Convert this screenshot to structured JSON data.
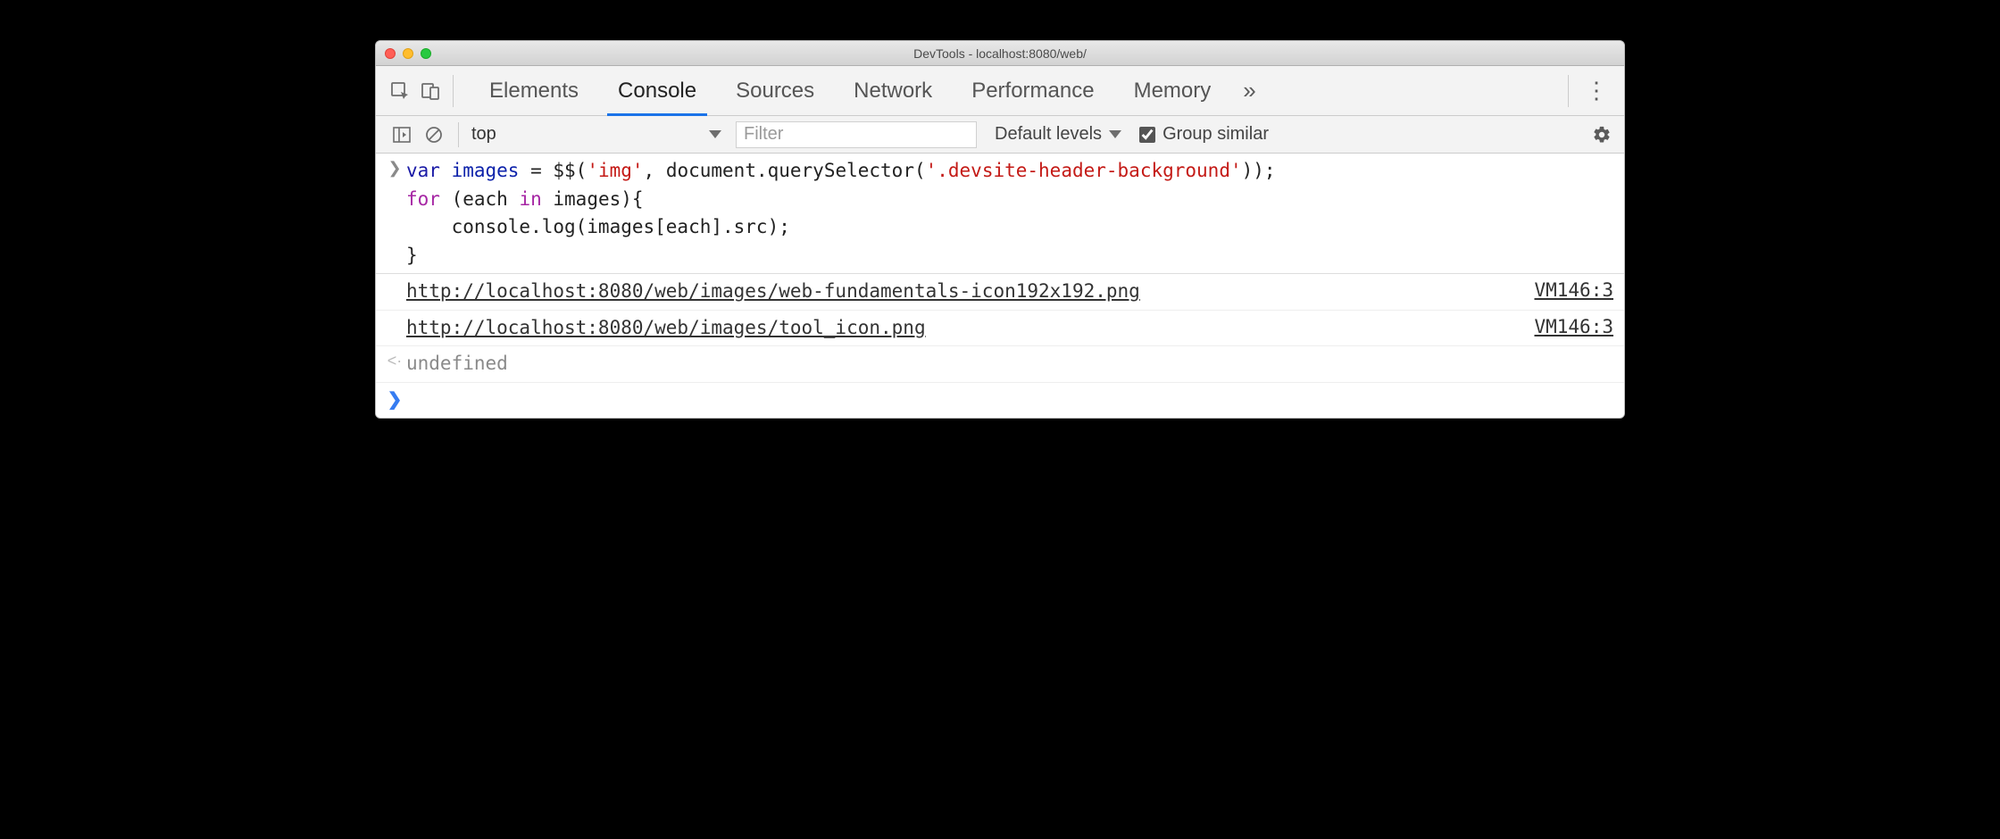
{
  "window": {
    "title": "DevTools - localhost:8080/web/"
  },
  "tabs": {
    "elements": "Elements",
    "console": "Console",
    "sources": "Sources",
    "network": "Network",
    "performance": "Performance",
    "memory": "Memory"
  },
  "toolbar": {
    "context": "top",
    "filter_placeholder": "Filter",
    "levels": "Default levels",
    "group_similar": "Group similar"
  },
  "code": {
    "line1_var": "var",
    "line1_sp1": " ",
    "line1_images": "images",
    "line1_eq": " = $$(",
    "line1_str1": "'img'",
    "line1_comma": ", document.querySelector(",
    "line1_str2": "'.devsite-header-background'",
    "line1_end": "));",
    "line2_for": "for",
    "line2_sp": " (each ",
    "line2_in": "in",
    "line2_rest": " images){",
    "line3": "    console.log(images[each].src);",
    "line4": "}"
  },
  "logs": [
    {
      "url": "http://localhost:8080/web/images/web-fundamentals-icon192x192.png",
      "source": "VM146:3"
    },
    {
      "url": "http://localhost:8080/web/images/tool_icon.png",
      "source": "VM146:3"
    }
  ],
  "result": "undefined"
}
